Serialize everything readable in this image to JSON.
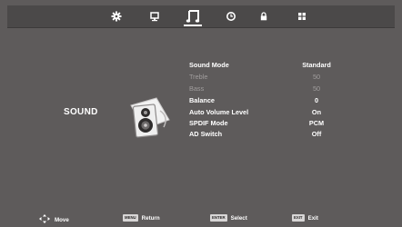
{
  "menu": {
    "items": [
      {
        "name": "picture",
        "icon": "gear-icon"
      },
      {
        "name": "screen",
        "icon": "monitor-icon"
      },
      {
        "name": "sound",
        "icon": "music-note-icon",
        "active": true
      },
      {
        "name": "time",
        "icon": "clock-icon"
      },
      {
        "name": "lock",
        "icon": "lock-icon"
      },
      {
        "name": "setup",
        "icon": "grid-icon"
      }
    ]
  },
  "section": {
    "title": "SOUND",
    "icon": "speaker-icon"
  },
  "settings": [
    {
      "label": "Sound Mode",
      "value": "Standard",
      "enabled": true
    },
    {
      "label": "Treble",
      "value": "50",
      "enabled": false
    },
    {
      "label": "Bass",
      "value": "50",
      "enabled": false
    },
    {
      "label": "Balance",
      "value": "0",
      "enabled": true
    },
    {
      "label": "Auto Volume Level",
      "value": "On",
      "enabled": true
    },
    {
      "label": "SPDIF Mode",
      "value": "PCM",
      "enabled": true
    },
    {
      "label": "AD Switch",
      "value": "Off",
      "enabled": true
    }
  ],
  "hints": {
    "move": {
      "icon": "dpad-icon",
      "label": "Move"
    },
    "return": {
      "key": "MENU",
      "label": "Return"
    },
    "select": {
      "key": "ENTER",
      "label": "Select"
    },
    "exit": {
      "key": "EXIT",
      "label": "Exit"
    }
  },
  "colors": {
    "background": "#5e5b5b",
    "menubar": "#4b4949",
    "text": "#ffffff",
    "disabled": "#a19e9e"
  }
}
